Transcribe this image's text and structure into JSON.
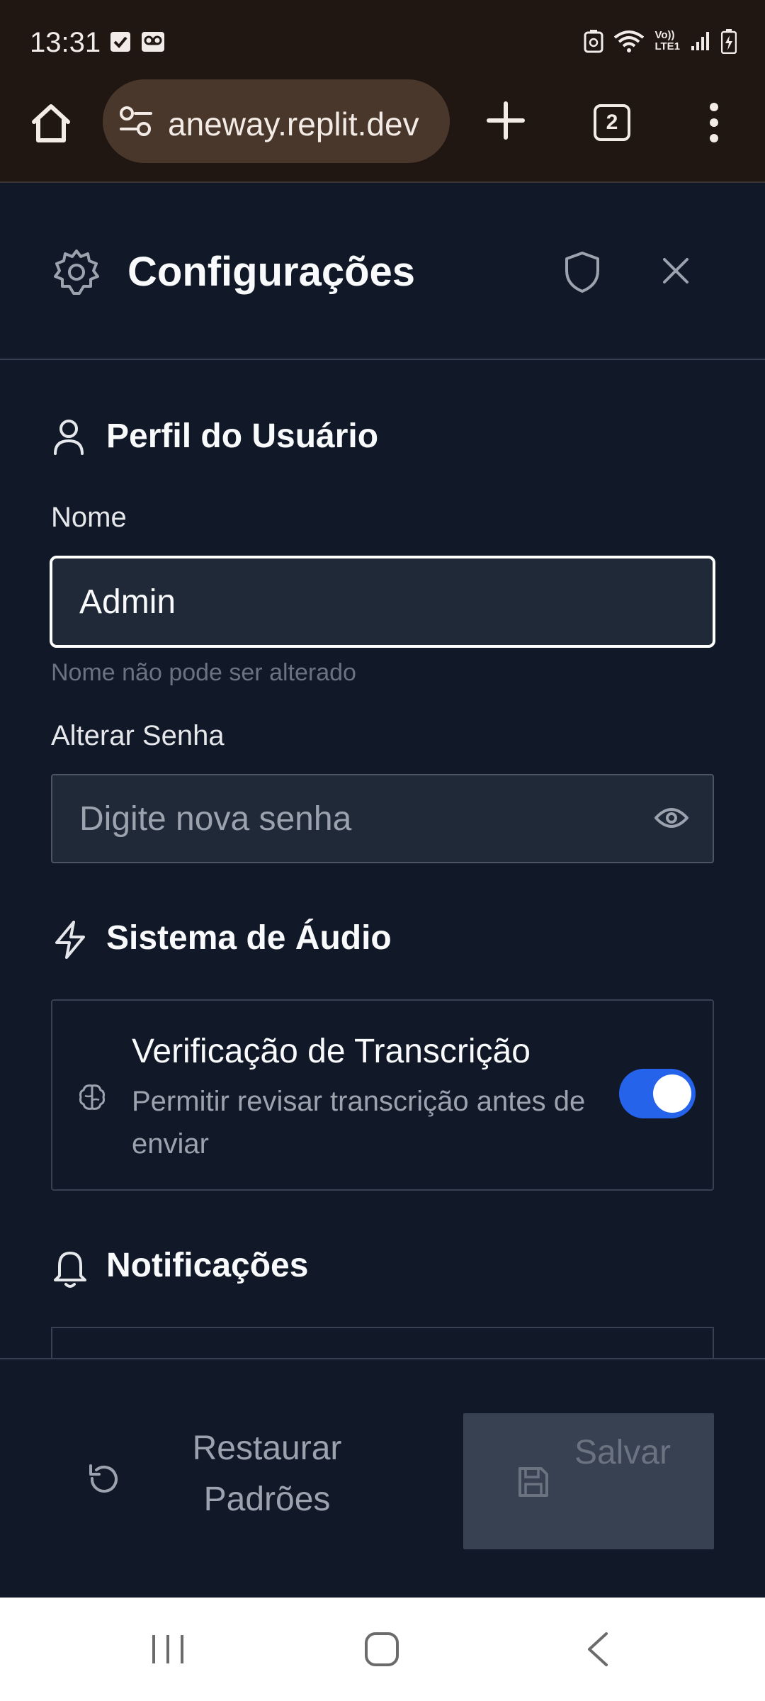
{
  "status_bar": {
    "time": "13:31",
    "left_icons": [
      "checkbox-notification-icon",
      "voicemail-icon"
    ],
    "right_icons": [
      "battery-saver-icon",
      "wifi-icon",
      "volte-lte-icon",
      "signal-icon",
      "battery-icon"
    ],
    "network_label_1": "Vo))",
    "network_label_2": "LTE1"
  },
  "browser": {
    "url": "aneway.replit.dev",
    "tab_count": "2"
  },
  "panel": {
    "title": "Configurações"
  },
  "profile": {
    "section_title": "Perfil do Usuário",
    "name_label": "Nome",
    "name_value": "Admin",
    "name_hint": "Nome não pode ser alterado",
    "password_label": "Alterar Senha",
    "password_placeholder": "Digite nova senha"
  },
  "audio": {
    "section_title": "Sistema de Áudio",
    "transcription_title": "Verificação de Transcrição",
    "transcription_desc": "Permitir revisar transcrição antes de enviar",
    "transcription_enabled": true
  },
  "notifications": {
    "section_title": "Notificações"
  },
  "footer": {
    "restore_label": "Restaurar Padrões",
    "save_label": "Salvar"
  },
  "colors": {
    "background": "#111827",
    "toggle_on": "#2563eb",
    "browser_chrome": "#201612",
    "url_pill": "#4a372b"
  }
}
